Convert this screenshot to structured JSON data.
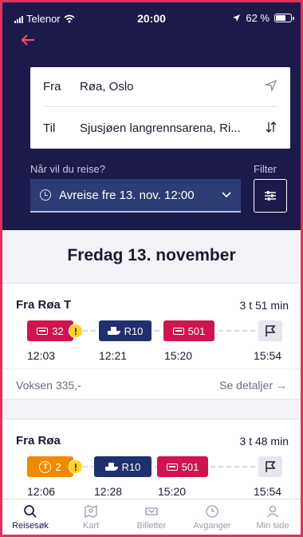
{
  "status_bar": {
    "carrier": "Telenor",
    "time": "20:00",
    "battery": "62 %"
  },
  "search": {
    "from_label": "Fra",
    "from_value": "Røa, Oslo",
    "to_label": "Til",
    "to_value": "Sjusjøen langrennsarena, Ri..."
  },
  "when": {
    "label": "Når vil du reise?",
    "value": "Avreise fre 13. nov. 12:00",
    "filter_label": "Filter"
  },
  "date_heading": "Fredag 13. november",
  "trips": [
    {
      "title": "Fra Røa T",
      "duration": "3 t 51 min",
      "legs": [
        {
          "mode": "bus",
          "line": "32"
        },
        {
          "mode": "boat",
          "line": "R10"
        },
        {
          "mode": "bus",
          "line": "501"
        }
      ],
      "times": [
        "12:03",
        "12:21",
        "15:20",
        "15:54"
      ],
      "price": "Voksen 335,-",
      "details": "Se detaljer →"
    },
    {
      "title": "Fra Røa",
      "duration": "3 t 48 min",
      "legs": [
        {
          "mode": "metro",
          "line": "2"
        },
        {
          "mode": "boat",
          "line": "R10"
        },
        {
          "mode": "bus",
          "line": "501"
        }
      ],
      "times": [
        "12:06",
        "12:28",
        "15:20",
        "15:54"
      ]
    }
  ],
  "tabs": [
    {
      "label": "Reisesøk",
      "icon": "search-icon",
      "active": true
    },
    {
      "label": "Kart",
      "icon": "map-icon",
      "active": false
    },
    {
      "label": "Billetter",
      "icon": "ticket-icon",
      "active": false
    },
    {
      "label": "Avganger",
      "icon": "clock-icon",
      "active": false
    },
    {
      "label": "Min side",
      "icon": "user-icon",
      "active": false
    }
  ],
  "colors": {
    "header_bg": "#1c1a4a",
    "bus": "#d0144f",
    "boat": "#20306e",
    "metro": "#f28a00",
    "accent": "#ff4d5e"
  }
}
